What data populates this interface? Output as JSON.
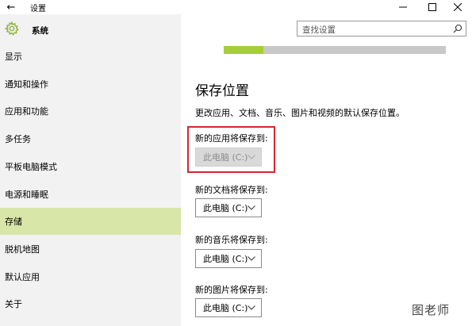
{
  "window": {
    "back_glyph": "←",
    "title": "设置",
    "min_glyph": "—",
    "max_glyph": "☐",
    "close_glyph": "✕"
  },
  "sidebar": {
    "header_label": "系统",
    "header_icon": "gear-icon",
    "items": [
      {
        "label": "显示",
        "active": false
      },
      {
        "label": "通知和操作",
        "active": false
      },
      {
        "label": "应用和功能",
        "active": false
      },
      {
        "label": "多任务",
        "active": false
      },
      {
        "label": "平板电脑模式",
        "active": false
      },
      {
        "label": "电源和睡眠",
        "active": false
      },
      {
        "label": "存储",
        "active": true
      },
      {
        "label": "脱机地图",
        "active": false
      },
      {
        "label": "默认应用",
        "active": false
      },
      {
        "label": "关于",
        "active": false
      }
    ]
  },
  "search": {
    "placeholder": "查找设置",
    "icon": "search-icon"
  },
  "storage": {
    "usage_fraction": 0.18,
    "section_title": "保存位置",
    "description": "更改应用、文档、音乐、图片和视频的默认保存位置。",
    "locations": [
      {
        "label": "新的应用将保存到:",
        "value": "此电脑 (C:)",
        "disabled": true
      },
      {
        "label": "新的文档将保存到:",
        "value": "此电脑 (C:)",
        "disabled": false
      },
      {
        "label": "新的音乐将保存到:",
        "value": "此电脑 (C:)",
        "disabled": false
      },
      {
        "label": "新的图片将保存到:",
        "value": "此电脑 (C:)",
        "disabled": false
      }
    ]
  },
  "watermark": "图老师",
  "colors": {
    "accent_selected": "#d8e6a8",
    "progress_fill": "#a6ce39",
    "highlight_border": "#d9252e",
    "sidebar_bg": "#f2f2f2"
  }
}
